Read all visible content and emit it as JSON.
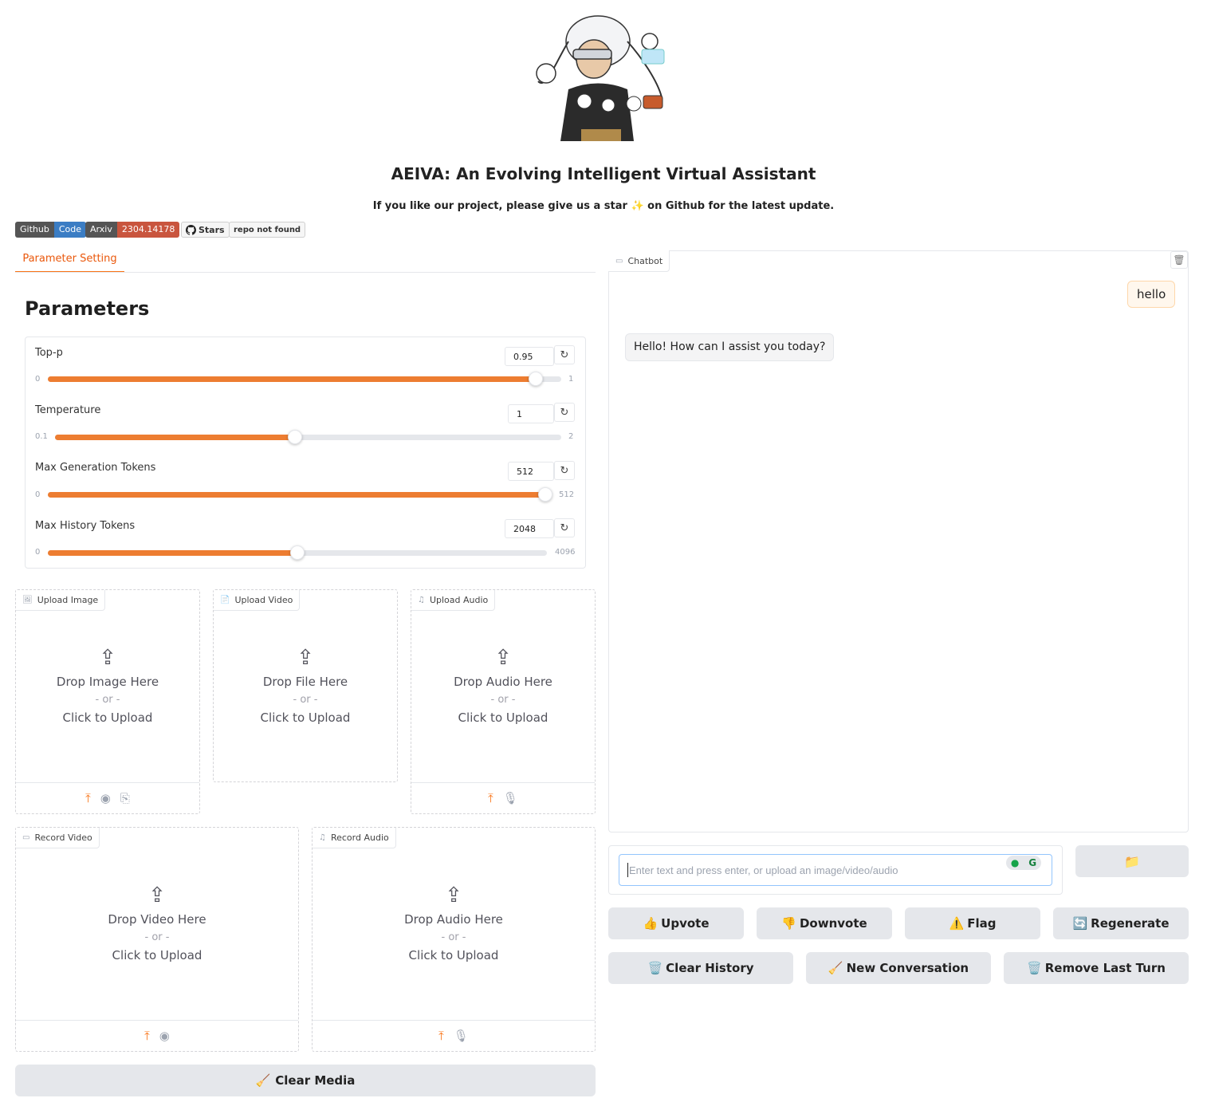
{
  "header": {
    "title": "AEIVA: An Evolving Intelligent Virtual Assistant",
    "subtitle": "If you like our project, please give us a star ✨ on Github for the latest update."
  },
  "badges": {
    "github_left": "Github",
    "github_right": "Code",
    "arxiv_left": "Arxiv",
    "arxiv_right": "2304.14178",
    "stars_label": "Stars",
    "stars_value": "repo not found"
  },
  "tabs": [
    {
      "label": "Parameter Setting"
    }
  ],
  "parameters": {
    "heading": "Parameters",
    "sliders": [
      {
        "label": "Top-p",
        "value": "0.95",
        "min": "0",
        "max": "1",
        "fraction": 0.95
      },
      {
        "label": "Temperature",
        "value": "1",
        "min": "0.1",
        "max": "2",
        "fraction": 0.474
      },
      {
        "label": "Max Generation Tokens",
        "value": "512",
        "min": "0",
        "max": "512",
        "fraction": 1.0
      },
      {
        "label": "Max History Tokens",
        "value": "2048",
        "min": "0",
        "max": "4096",
        "fraction": 0.5
      }
    ]
  },
  "uploads": {
    "image": {
      "tag": "Upload Image",
      "main": "Drop Image Here",
      "or": "- or -",
      "click": "Click to Upload"
    },
    "video": {
      "tag": "Upload Video",
      "main": "Drop File Here",
      "or": "- or -",
      "click": "Click to Upload"
    },
    "audio": {
      "tag": "Upload Audio",
      "main": "Drop Audio Here",
      "or": "- or -",
      "click": "Click to Upload"
    },
    "record_video": {
      "tag": "Record Video",
      "main": "Drop Video Here",
      "or": "- or -",
      "click": "Click to Upload"
    },
    "record_audio": {
      "tag": "Record Audio",
      "main": "Drop Audio Here",
      "or": "- or -",
      "click": "Click to Upload"
    }
  },
  "clear_media": {
    "icon": "🧹",
    "label": "Clear Media"
  },
  "chatbot": {
    "tag": "Chatbot",
    "messages": [
      {
        "role": "user",
        "text": "hello"
      },
      {
        "role": "bot",
        "text": "Hello! How can I assist you today?"
      }
    ],
    "input_placeholder": "Enter text and press enter, or upload an image/video/audio",
    "folder_icon": "📁"
  },
  "actions": {
    "row1": [
      {
        "icon": "👍",
        "label": "Upvote"
      },
      {
        "icon": "👎",
        "label": "Downvote"
      },
      {
        "icon": "⚠️",
        "label": "Flag"
      },
      {
        "icon": "🔄",
        "label": "Regenerate"
      }
    ],
    "row2": [
      {
        "icon": "🗑️",
        "label": "Clear History"
      },
      {
        "icon": "🧹",
        "label": "New Conversation"
      },
      {
        "icon": "🗑️",
        "label": "Remove Last Turn"
      }
    ]
  },
  "colors": {
    "accent": "#ed7d31",
    "tab_accent": "#ea580c",
    "button_bg": "#e5e7eb"
  }
}
